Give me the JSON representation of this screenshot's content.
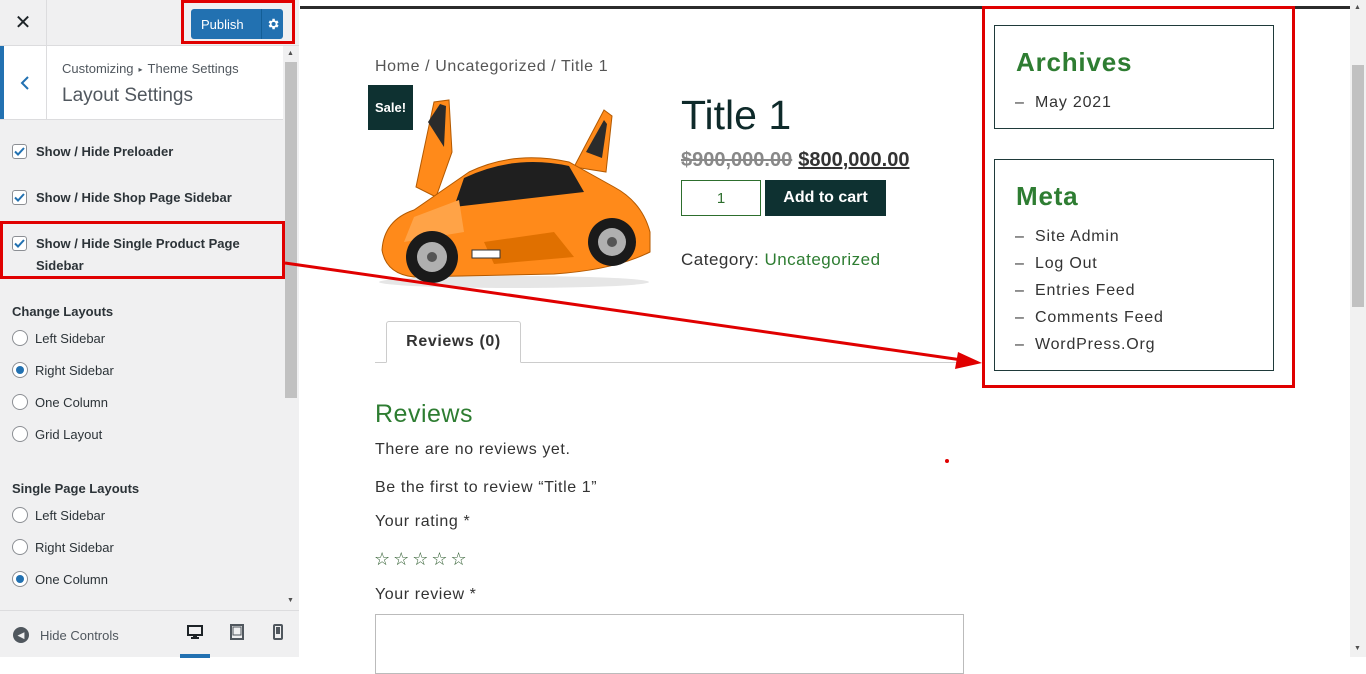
{
  "customizer": {
    "publish_label": "Publish",
    "breadcrumb_root": "Customizing",
    "breadcrumb_section": "Theme Settings",
    "panel_title": "Layout Settings",
    "checkboxes": [
      {
        "label": "Show / Hide Preloader",
        "checked": true
      },
      {
        "label": "Show / Hide Shop Page Sidebar",
        "checked": true
      },
      {
        "label": "Show / Hide Single Product Page Sidebar",
        "checked": true
      }
    ],
    "change_layouts": {
      "title": "Change Layouts",
      "options": [
        "Left Sidebar",
        "Right Sidebar",
        "One Column",
        "Grid Layout"
      ],
      "selected": "Right Sidebar"
    },
    "single_page_layouts": {
      "title": "Single Page Layouts",
      "options": [
        "Left Sidebar",
        "Right Sidebar",
        "One Column"
      ],
      "selected": "One Column"
    },
    "hide_controls_label": "Hide Controls",
    "devices": [
      "desktop-icon",
      "tablet-icon",
      "mobile-icon"
    ],
    "active_device": "desktop"
  },
  "product": {
    "breadcrumb": "Home / Uncategorized / Title 1",
    "sale_badge": "Sale!",
    "title": "Title 1",
    "old_price": "$900,000.00",
    "new_price": "$800,000.00",
    "quantity": "1",
    "add_to_cart": "Add to cart",
    "category_label": "Category:",
    "category_value": "Uncategorized",
    "tab_reviews": "Reviews (0)",
    "reviews_heading": "Reviews",
    "no_reviews": "There are no reviews yet.",
    "be_first": "Be the first to review “Title 1”",
    "your_rating": "Your rating *",
    "stars": "☆☆☆☆☆",
    "your_review": "Your review *"
  },
  "sidebar": {
    "archives_title": "Archives",
    "archives": [
      "May 2021"
    ],
    "meta_title": "Meta",
    "meta": [
      "Site Admin",
      "Log Out",
      "Entries Feed",
      "Comments Feed",
      "WordPress.Org"
    ]
  },
  "colors": {
    "accent": "#2271b1",
    "dark_teal": "#0e3131",
    "green": "#2e7d32",
    "highlight": "#e00000"
  }
}
